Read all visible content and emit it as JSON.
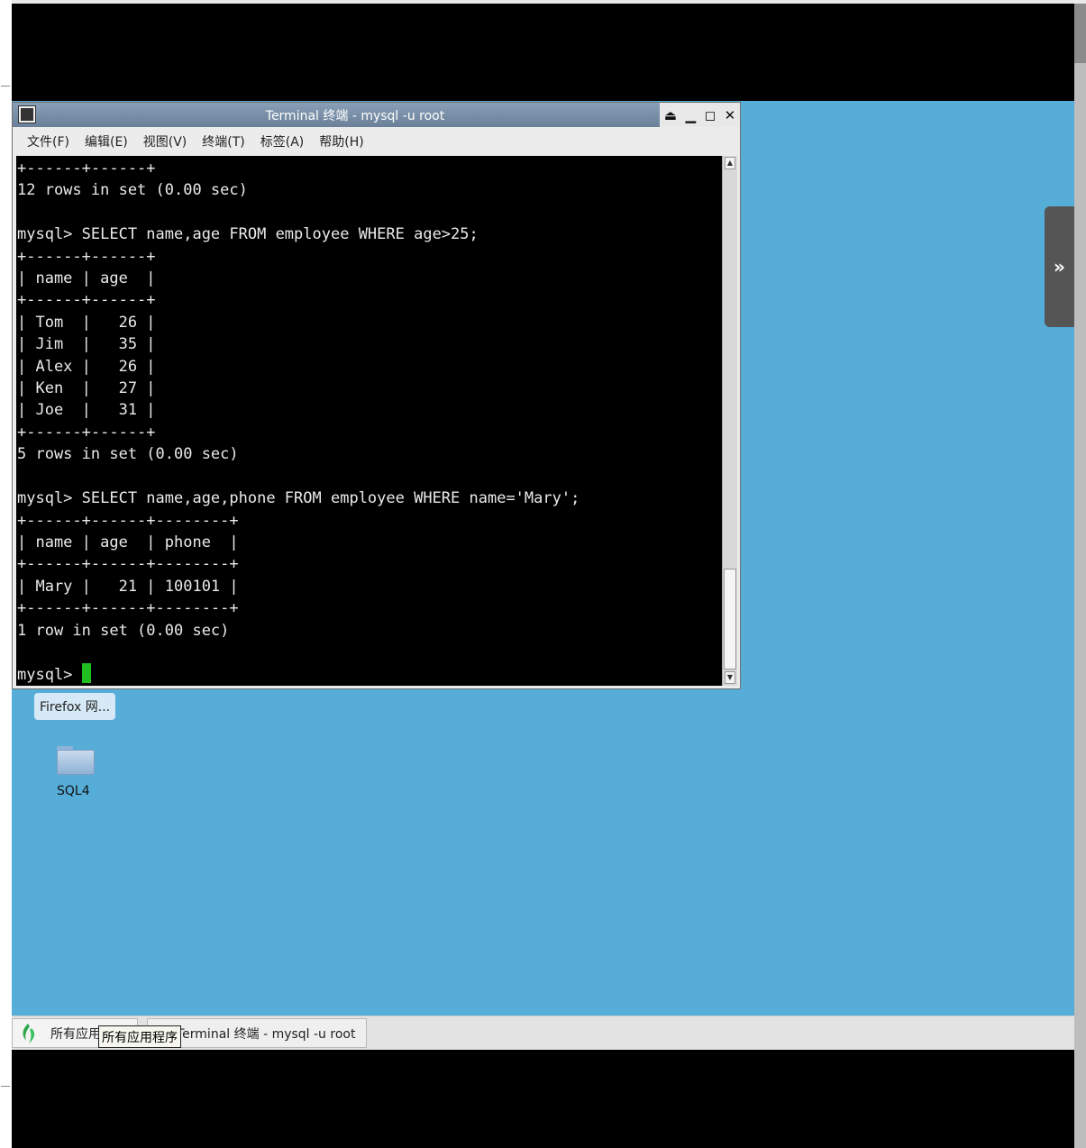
{
  "window": {
    "title": "Terminal 终端 - mysql -u root",
    "controls": {
      "shade": "⏏",
      "minimize": "▁",
      "maximize": "◻",
      "close": "✕"
    }
  },
  "menubar": {
    "items": [
      "文件(F)",
      "编辑(E)",
      "视图(V)",
      "终端(T)",
      "标签(A)",
      "帮助(H)"
    ]
  },
  "terminal": {
    "lines": [
      "+------+------+",
      "12 rows in set (0.00 sec)",
      "",
      "mysql> SELECT name,age FROM employee WHERE age>25;",
      "+------+------+",
      "| name | age  |",
      "+------+------+",
      "| Tom  |   26 |",
      "| Jim  |   35 |",
      "| Alex |   26 |",
      "| Ken  |   27 |",
      "| Joe  |   31 |",
      "+------+------+",
      "5 rows in set (0.00 sec)",
      "",
      "mysql> SELECT name,age,phone FROM employee WHERE name='Mary';",
      "+------+------+--------+",
      "| name | age  | phone  |",
      "+------+------+--------+",
      "| Mary |   21 | 100101 |",
      "+------+------+--------+",
      "1 row in set (0.00 sec)",
      ""
    ],
    "prompt": "mysql> "
  },
  "desktop": {
    "firefox_label": "Firefox 网...",
    "folder_label": "SQL4",
    "side_tab_icon": "»"
  },
  "taskbar": {
    "start_label": "所有应用",
    "task_label": "Terminal 终端 - mysql -u root",
    "tooltip": "所有应用程序"
  }
}
